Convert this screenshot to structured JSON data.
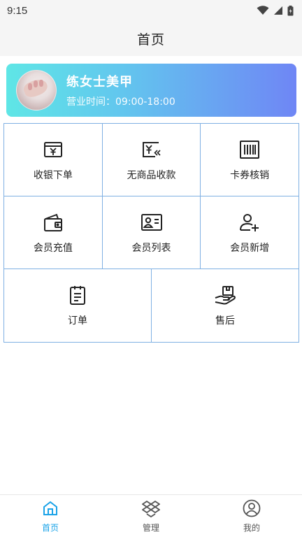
{
  "status_bar": {
    "time": "9:15"
  },
  "header": {
    "title": "首页"
  },
  "store": {
    "name": "练女士美甲",
    "hours": "营业时间：09:00-18:00"
  },
  "grid": {
    "items": [
      {
        "label": "收银下单",
        "icon": "yen-register-icon"
      },
      {
        "label": "无商品收款",
        "icon": "yen-receive-icon"
      },
      {
        "label": "卡券核销",
        "icon": "barcode-icon"
      },
      {
        "label": "会员充值",
        "icon": "wallet-icon"
      },
      {
        "label": "会员列表",
        "icon": "id-card-icon"
      },
      {
        "label": "会员新增",
        "icon": "add-user-icon"
      },
      {
        "label": "订单",
        "icon": "clipboard-icon"
      },
      {
        "label": "售后",
        "icon": "hand-box-icon"
      }
    ]
  },
  "bottom_nav": {
    "items": [
      {
        "label": "首页",
        "icon": "home-icon",
        "active": true
      },
      {
        "label": "管理",
        "icon": "dropbox-icon",
        "active": false
      },
      {
        "label": "我的",
        "icon": "user-circle-icon",
        "active": false
      }
    ]
  },
  "colors": {
    "accent": "#1aa3e8",
    "grid_border": "#7fb0e3",
    "card_start": "#5fe6e6",
    "card_end": "#6f86f5"
  }
}
